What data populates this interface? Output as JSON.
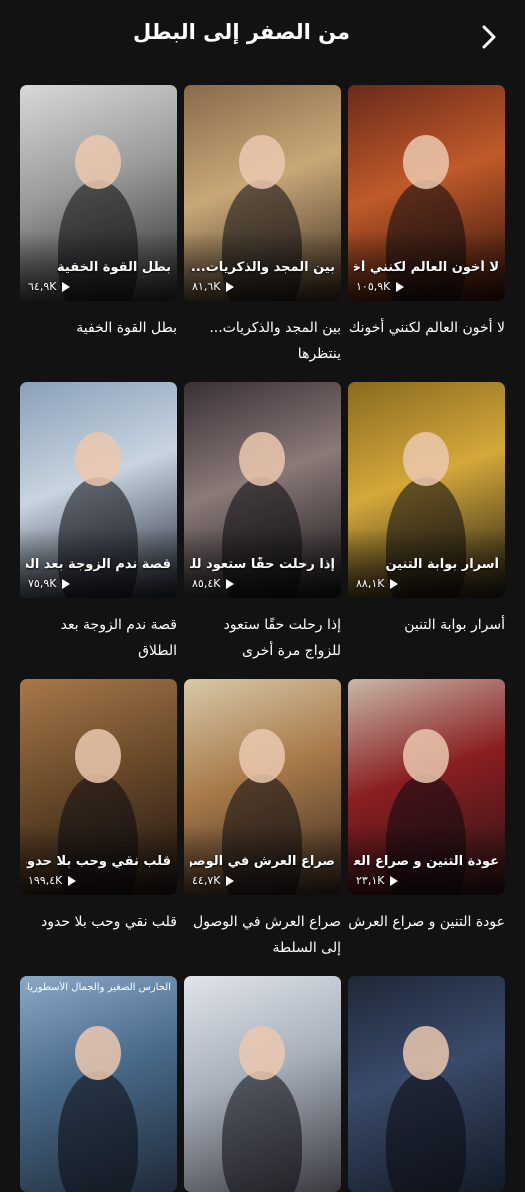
{
  "header": {
    "title": "من الصفر إلى البطل",
    "back_icon": "chevron-right-icon"
  },
  "cards": [
    {
      "caption": "لا أخون العالم لكنني أخونك",
      "poster_title": "لا أخون العالم لكنني أخونك",
      "views": "١٠٥,٩K",
      "colors": [
        "#6b2a1a",
        "#c05a2a",
        "#2b0f0a"
      ]
    },
    {
      "caption": "بين المجد والذكريات... ينتظرها",
      "poster_title": "بين المجد والذكريات...ينتظرها",
      "views": "٨١,٦K",
      "colors": [
        "#8a6a4a",
        "#c8a878",
        "#3a2a1e"
      ]
    },
    {
      "caption": "بطل القوة الخفية",
      "poster_title": "بطل القوة الخفية",
      "views": "٦٤,٩K",
      "colors": [
        "#d8d8d8",
        "#9a9a9a",
        "#2a2a2a"
      ]
    },
    {
      "caption": "أسرار بوابة التنين",
      "poster_title": "أسرار بوابة التنين",
      "views": "٨٨,١K",
      "colors": [
        "#8a6a20",
        "#d4a83a",
        "#1e1a14"
      ]
    },
    {
      "caption": "إذا رحلت حقًا ستعود للزواج مرة أخرى",
      "poster_title": "إذا رحلت حقًا ستعود للزواج مرة أخرى",
      "views": "٨٥,٤K",
      "colors": [
        "#3a3034",
        "#8a7a78",
        "#141214"
      ]
    },
    {
      "caption": "قصة ندم الزوجة بعد الطلاق",
      "poster_title": "قصة ندم الزوجة بعد الطلاق",
      "views": "٧٥,٩K",
      "colors": [
        "#8aa0b8",
        "#c8d4e0",
        "#1e2430"
      ]
    },
    {
      "caption": "عودة التنين و صراع العرش",
      "poster_title": "عودة التنين و صراع العرش",
      "views": "٢٣,١K",
      "colors": [
        "#c8b8a8",
        "#8a1e22",
        "#2a1414"
      ]
    },
    {
      "caption": "صراع العرش في الوصول إلى السلطة",
      "poster_title": "صراع العرش في الوصول إلى السلطة",
      "views": "٤٤,٧K",
      "colors": [
        "#d8c8a8",
        "#a87a4a",
        "#3a2a20"
      ]
    },
    {
      "caption": "قلب نقي وحب بلا حدود",
      "poster_title": "قلب نقي وحب بلا حدود",
      "views": "١٩٩,٤K",
      "colors": [
        "#a8784a",
        "#6a4a2a",
        "#1e1410"
      ]
    },
    {
      "caption": "",
      "poster_title": "",
      "views": "",
      "colors": [
        "#1e2838",
        "#3a4a6a",
        "#121a24"
      ]
    },
    {
      "caption": "",
      "poster_title": "",
      "views": "",
      "colors": [
        "#e0e4ea",
        "#a8b0bc",
        "#3a3a40"
      ]
    },
    {
      "caption": "",
      "poster_title": "الحارس الصغير والجمال الأسطوريان",
      "views": "",
      "colors": [
        "#8aa8c8",
        "#4a6a8a",
        "#1e2a38"
      ]
    }
  ]
}
